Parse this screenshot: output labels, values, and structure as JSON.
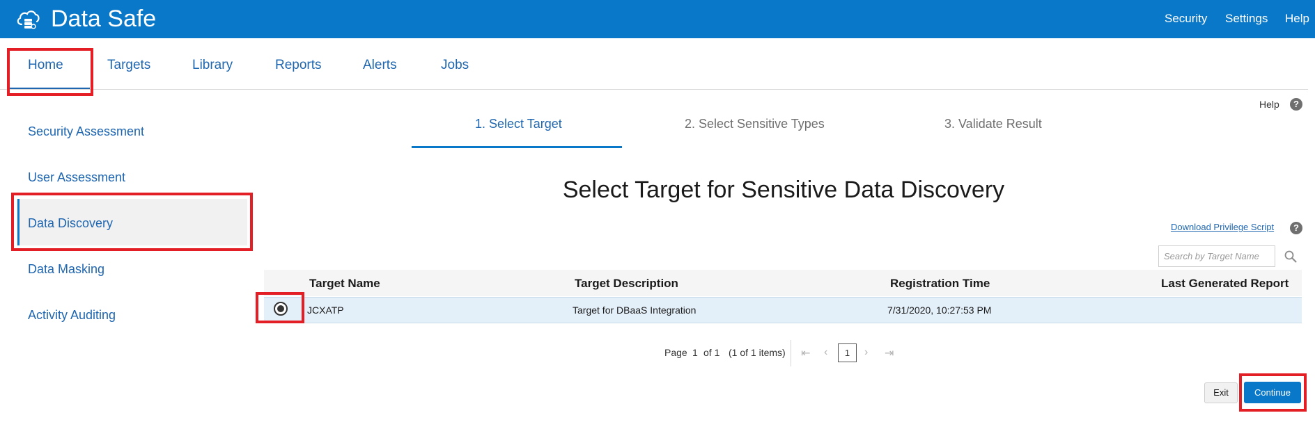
{
  "header": {
    "title": "Data Safe",
    "logo_icon": "cloud-database-icon",
    "links": [
      "Security",
      "Settings",
      "Help"
    ]
  },
  "nav": {
    "tabs": [
      "Home",
      "Targets",
      "Library",
      "Reports",
      "Alerts",
      "Jobs"
    ],
    "active": "Home"
  },
  "sidebar": {
    "items": [
      "Security Assessment",
      "User Assessment",
      "Data Discovery",
      "Data Masking",
      "Activity Auditing"
    ],
    "active": "Data Discovery"
  },
  "help": {
    "label": "Help",
    "icon": "question-icon"
  },
  "steps": [
    {
      "label": "1. Select Target",
      "active": true
    },
    {
      "label": "2. Select Sensitive Types",
      "active": false
    },
    {
      "label": "3. Validate Result",
      "active": false
    }
  ],
  "page_title": "Select Target for Sensitive Data Discovery",
  "download_link": "Download Privilege Script",
  "search": {
    "placeholder": "Search by Target Name",
    "value": ""
  },
  "table": {
    "columns": [
      "Target Name",
      "Target Description",
      "Registration Time",
      "Last Generated Report"
    ],
    "rows": [
      {
        "selected": true,
        "target_name": "JCXATP",
        "target_description": "Target for DBaaS Integration",
        "registration_time": "7/31/2020, 10:27:53 PM",
        "last_generated_report": ""
      }
    ]
  },
  "pagination": {
    "page_label": "Page",
    "current": "1",
    "of_label": "of 1",
    "items_label": "(1 of 1 items)",
    "page_button": "1"
  },
  "buttons": {
    "exit": "Exit",
    "continue": "Continue"
  },
  "colors": {
    "header_bg": "#0978c8",
    "link": "#1f66b0",
    "highlight": "#e31e24",
    "selected_row": "#e4f0f9"
  }
}
